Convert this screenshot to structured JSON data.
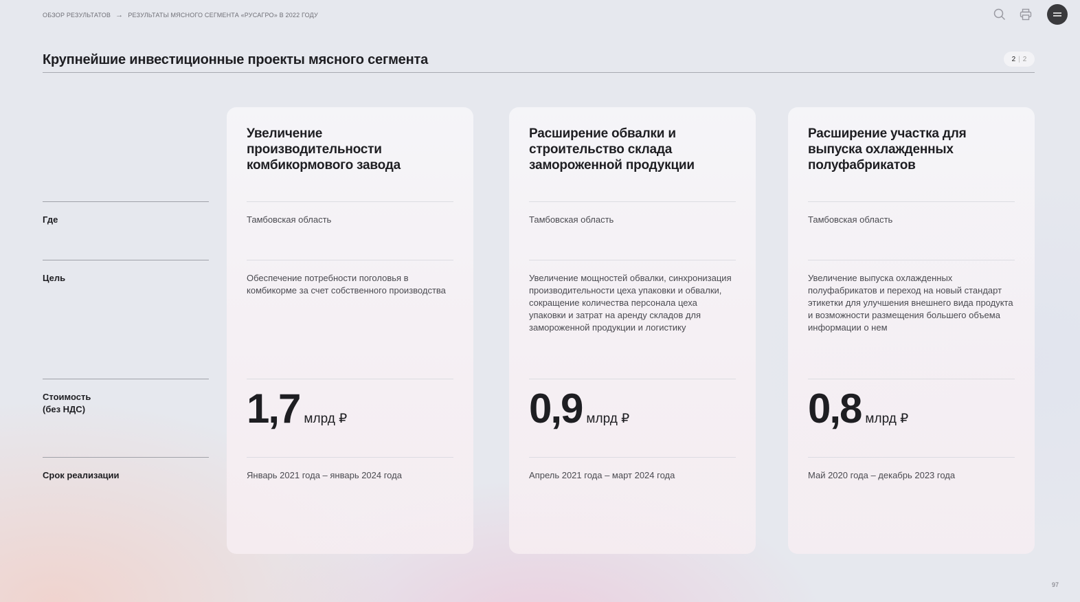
{
  "breadcrumb": {
    "parent": "ОБЗОР РЕЗУЛЬТАТОВ",
    "current": "РЕЗУЛЬТАТЫ МЯСНОГО СЕГМЕНТА «РУСАГРО» В 2022 ГОДУ"
  },
  "header": {
    "title": "Крупнейшие инвестиционные проекты мясного сегмента",
    "pager": {
      "current": "2",
      "total": "2"
    },
    "icons": [
      "search-icon",
      "print-icon",
      "menu-icon"
    ]
  },
  "row_labels": {
    "where": "Где",
    "goal": "Цель",
    "cost": "Стоимость\n(без НДС)",
    "period": "Срок реализации"
  },
  "projects": [
    {
      "title": "Увеличение производительности комбикормового завода",
      "where": "Тамбовская область",
      "goal": "Обеспечение потребности поголовья в комбикорме за счет собственного производства",
      "cost_value": "1,7",
      "cost_unit": "млрд ₽",
      "period": "Январь 2021 года – январь 2024 года"
    },
    {
      "title": "Расширение обвалки и строительство склада замороженной продукции",
      "where": "Тамбовская область",
      "goal": "Увеличение мощностей обвалки, синхронизация производительности цеха упаковки и обвалки, сокращение количества персонала цеха упаковки и затрат на аренду складов для замороженной продукции и логистику",
      "cost_value": "0,9",
      "cost_unit": "млрд ₽",
      "period": "Апрель 2021 года – март 2024 года"
    },
    {
      "title": "Расширение участка для выпуска охлажденных полуфабрикатов",
      "where": "Тамбовская область",
      "goal": "Увеличение выпуска охлажденных полуфабрикатов и переход на новый стандарт этикетки для улучшения внешнего вида продукта и возможности размещения большего объема информации о нем",
      "cost_value": "0,8",
      "cost_unit": "млрд ₽",
      "period": "Май 2020 года – декабрь 2023 года"
    }
  ],
  "page_number": "97"
}
